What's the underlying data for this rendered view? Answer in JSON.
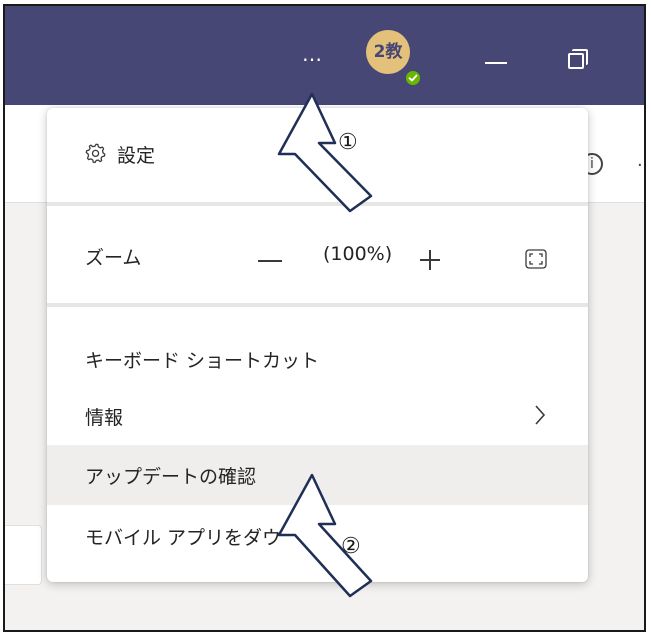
{
  "titlebar": {
    "more_label": "…",
    "avatar_text": "2教",
    "presence_status": "available"
  },
  "menu": {
    "settings": "設定",
    "zoom": {
      "label": "ズーム",
      "value": "(100%)"
    },
    "keyboard_shortcuts": "キーボード ショートカット",
    "info": "情報",
    "check_updates": "アップデートの確認",
    "mobile_app": "モバイル アプリをダウ"
  },
  "annotations": {
    "step1": "①",
    "step2": "②"
  },
  "colors": {
    "titlebar": "#464775",
    "presence": "#6bb700",
    "avatar_bg": "#e4c17a",
    "hover_row": "#f0eeed"
  },
  "icons": [
    "gear-icon",
    "more-icon",
    "minimize-icon",
    "restore-icon",
    "fullscreen-icon",
    "chevron-right-icon",
    "info-icon"
  ]
}
